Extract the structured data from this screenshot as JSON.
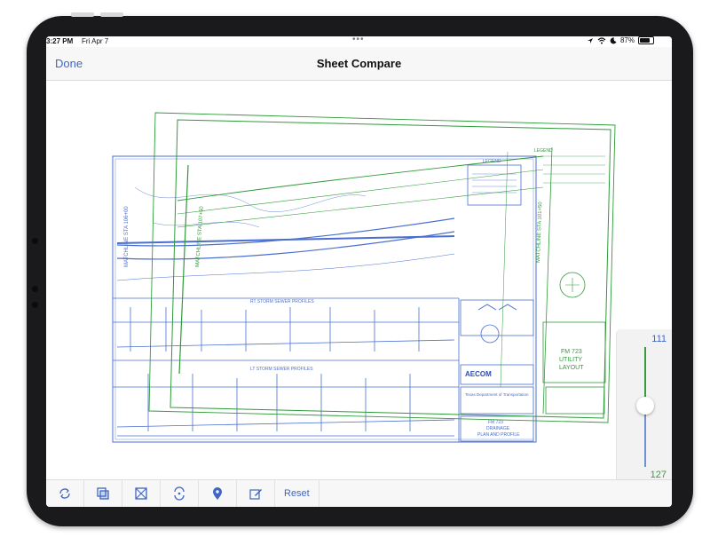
{
  "status": {
    "time": "3:27 PM",
    "date": "Fri Apr 7",
    "battery": "87%",
    "dots": "•••"
  },
  "nav": {
    "done_label": "Done",
    "title": "Sheet Compare"
  },
  "slider": {
    "top_value": "111",
    "bottom_value": "127",
    "top_color": "#3f66c4",
    "bottom_color": "#3c9a3c"
  },
  "drawing_blue": {
    "matchline_left": "MATCHLINE STA 106+00",
    "profile_rt": "RT STORM SEWER PROFILES",
    "profile_lt": "LT STORM SEWER PROFILES",
    "legend": "LEGEND",
    "firm": "AECOM",
    "agency": "Texas Department of Transportation",
    "sheet_title_1": "FM 723",
    "sheet_title_2": "DRAINAGE",
    "sheet_title_3": "PLAN AND PROFILE",
    "color": "#4a6fd0"
  },
  "drawing_green": {
    "matchline_left": "MATCHLINE STA 107+50",
    "matchline_right": "MATCHLINE STA 101+50",
    "legend": "LEGEND",
    "title_1": "FM 723",
    "title_2": "UTILITY",
    "title_3": "LAYOUT",
    "color": "#2f9a3a"
  },
  "toolbar": {
    "reset_label": "Reset"
  }
}
